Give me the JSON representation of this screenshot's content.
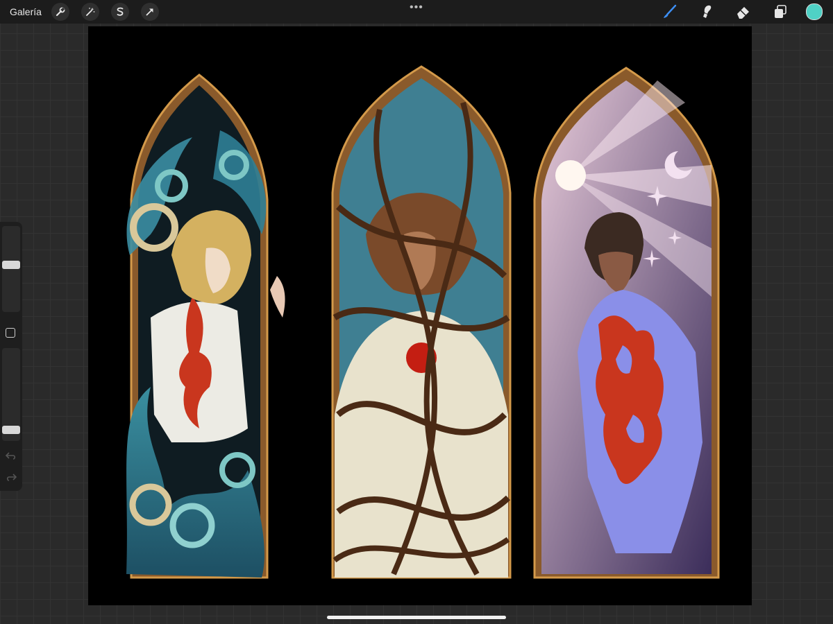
{
  "topbar": {
    "gallery_label": "Galería",
    "tools": [
      "wrench-icon",
      "magic-wand-icon",
      "selection-icon",
      "transform-arrow-icon"
    ],
    "more_label": "•••",
    "right_tools": [
      "brush-icon",
      "smudge-icon",
      "eraser-icon",
      "layers-icon"
    ],
    "active_tool": "brush-icon",
    "current_color": "#4fd1c5"
  },
  "sidebar": {
    "size_level": 0.55,
    "opacity_level": 0.08
  }
}
